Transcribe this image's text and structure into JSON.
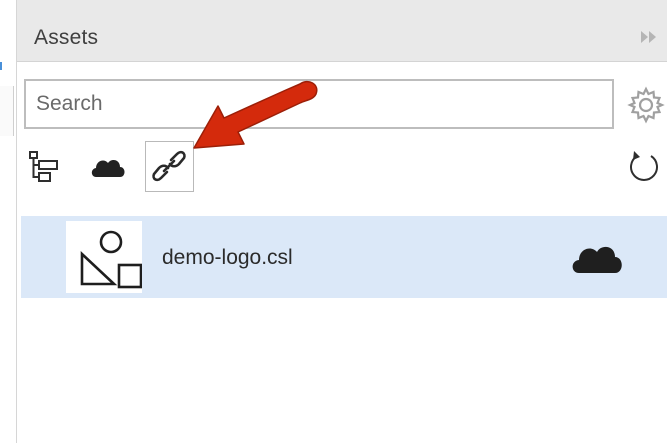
{
  "panel": {
    "title": "Assets"
  },
  "search": {
    "placeholder": "Search",
    "value": ""
  },
  "toolbar": {
    "buttons": [
      {
        "name": "hierarchy",
        "icon": "hierarchy-icon"
      },
      {
        "name": "cloud",
        "icon": "cloud-icon"
      },
      {
        "name": "linked",
        "icon": "link-icon",
        "active": true
      },
      {
        "name": "refresh",
        "icon": "refresh-icon"
      }
    ]
  },
  "assets": [
    {
      "name": "demo-logo.csl",
      "thumbnail_icon": "shapes-icon",
      "status_icon": "cloud-icon",
      "selected": true
    }
  ],
  "colors": {
    "header_bg": "#e9e9e9",
    "selected_row_bg": "#dbe8f8",
    "annotation_arrow": "#d42a0c"
  }
}
